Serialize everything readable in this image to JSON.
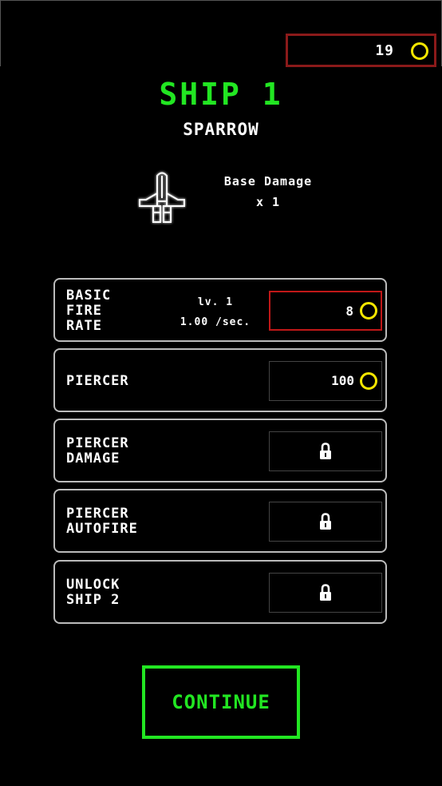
{
  "hud": {
    "coins": "19"
  },
  "ship": {
    "title": "SHIP 1",
    "name": "SPARROW",
    "stat_label": "Base Damage",
    "stat_value": "x 1"
  },
  "upgrades": [
    {
      "name_lines": [
        "BASIC",
        "FIRE",
        "RATE"
      ],
      "level": "lv. 1",
      "rate": "1.00 /sec.",
      "price": "8",
      "state": "affordable-highlighted"
    },
    {
      "name_lines": [
        "PIERCER"
      ],
      "price": "100",
      "state": "available"
    },
    {
      "name_lines": [
        "PIERCER",
        "DAMAGE"
      ],
      "state": "locked"
    },
    {
      "name_lines": [
        "PIERCER",
        "AUTOFIRE"
      ],
      "state": "locked"
    },
    {
      "name_lines": [
        "UNLOCK",
        "SHIP 2"
      ],
      "state": "locked"
    }
  ],
  "continue_label": "CONTINUE",
  "colors": {
    "accent_green": "#22e622",
    "coin_yellow": "#f5e600",
    "highlight_red": "#c01818",
    "counter_border": "#8b1a1a",
    "background": "#000000"
  },
  "icons": {
    "coin": "coin-icon",
    "lock": "lock-icon",
    "ship": "ship-sparrow-icon"
  }
}
